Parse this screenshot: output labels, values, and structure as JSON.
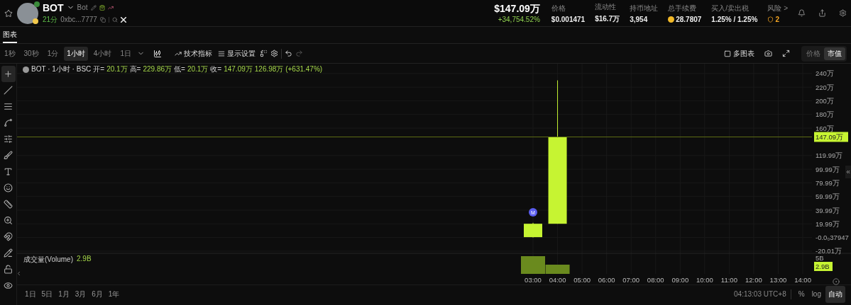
{
  "header": {
    "token": {
      "symbol": "BOT",
      "name": "Bot",
      "age": "21分",
      "address": "0xbc...7777"
    },
    "market_cap": {
      "value": "$147.09万",
      "change": "+34,754.52%"
    },
    "stats": [
      {
        "label": "价格",
        "value": "$0.001471",
        "kind": "plain"
      },
      {
        "label": "流动性",
        "value": "$16.7万",
        "kind": "plain"
      },
      {
        "label": "持币地址",
        "value": "3,954",
        "kind": "plain"
      },
      {
        "label": "总手续费",
        "value": "28.7807",
        "kind": "coin"
      },
      {
        "label": "买入/卖出税",
        "value": "1.25% / 1.25%",
        "kind": "plain"
      },
      {
        "label": "风险 >",
        "value": "2",
        "kind": "risk"
      }
    ]
  },
  "tabs": [
    {
      "label": "图表",
      "selected": true
    }
  ],
  "toolbar": {
    "intervals": [
      {
        "label": "1秒",
        "selected": false
      },
      {
        "label": "30秒",
        "selected": false
      },
      {
        "label": "1分",
        "selected": false
      },
      {
        "label": "1小时",
        "selected": true
      },
      {
        "label": "4小时",
        "selected": false
      },
      {
        "label": "1日",
        "selected": false
      }
    ],
    "indicators": "技术指标",
    "display": "显示设置",
    "redo_disabled": true,
    "multi_chart": {
      "label": "多图表",
      "checked": false
    },
    "modes": [
      {
        "label": "价格",
        "selected": false
      },
      {
        "label": "市值",
        "selected": true
      }
    ]
  },
  "drawing_tools": [
    {
      "kind": "crosshair",
      "selected": true
    },
    {
      "kind": "line",
      "selected": false
    },
    {
      "kind": "lines",
      "selected": false
    },
    {
      "kind": "path",
      "selected": false
    },
    {
      "kind": "fib",
      "selected": false
    },
    {
      "kind": "brush",
      "selected": false
    },
    {
      "kind": "text",
      "selected": false
    },
    {
      "kind": "emoji",
      "selected": false
    },
    {
      "kind": "ruler",
      "selected": false
    },
    {
      "kind": "zoom",
      "selected": false
    },
    {
      "kind": "magnet",
      "selected": false
    },
    {
      "kind": "pencil",
      "selected": false
    },
    {
      "kind": "lock",
      "selected": false
    },
    {
      "kind": "eye",
      "selected": false
    }
  ],
  "chart": {
    "legend": {
      "title": "BOT · 1小时 · BSC",
      "ohlc": [
        {
          "label": "开=",
          "value": "20.1万"
        },
        {
          "label": "高=",
          "value": "229.86万"
        },
        {
          "label": "低=",
          "value": "20.1万"
        },
        {
          "label": "收=",
          "value": "147.09万"
        }
      ],
      "change": "126.98万 (+631.47%)"
    },
    "last_price_tag": "147.09万",
    "marker": "M",
    "volume": {
      "label": "成交量(Volume)",
      "value": "2.9B",
      "axis_label": "5B",
      "last_tag": "2.9B"
    },
    "time_labels": [
      "03:00",
      "04:00",
      "05:00",
      "06:00",
      "07:00",
      "08:00",
      "09:00",
      "10:00",
      "11:00",
      "12:00",
      "13:00",
      "14:00"
    ],
    "price_labels": [
      "240万",
      "220万",
      "200万",
      "180万",
      "160万",
      "119.99万",
      "99.99万",
      "79.99万",
      "59.99万",
      "39.99万",
      "19.99万",
      "-0.0₀37947",
      "-20.01万"
    ]
  },
  "bottom": {
    "ranges": [
      "1日",
      "5日",
      "1月",
      "3月",
      "6月",
      "1年"
    ],
    "time": "04:13:03 UTC+8",
    "scale_buttons": [
      {
        "label": "%",
        "selected": false
      },
      {
        "label": "log",
        "selected": false
      },
      {
        "label": "自动",
        "selected": true
      }
    ]
  }
}
